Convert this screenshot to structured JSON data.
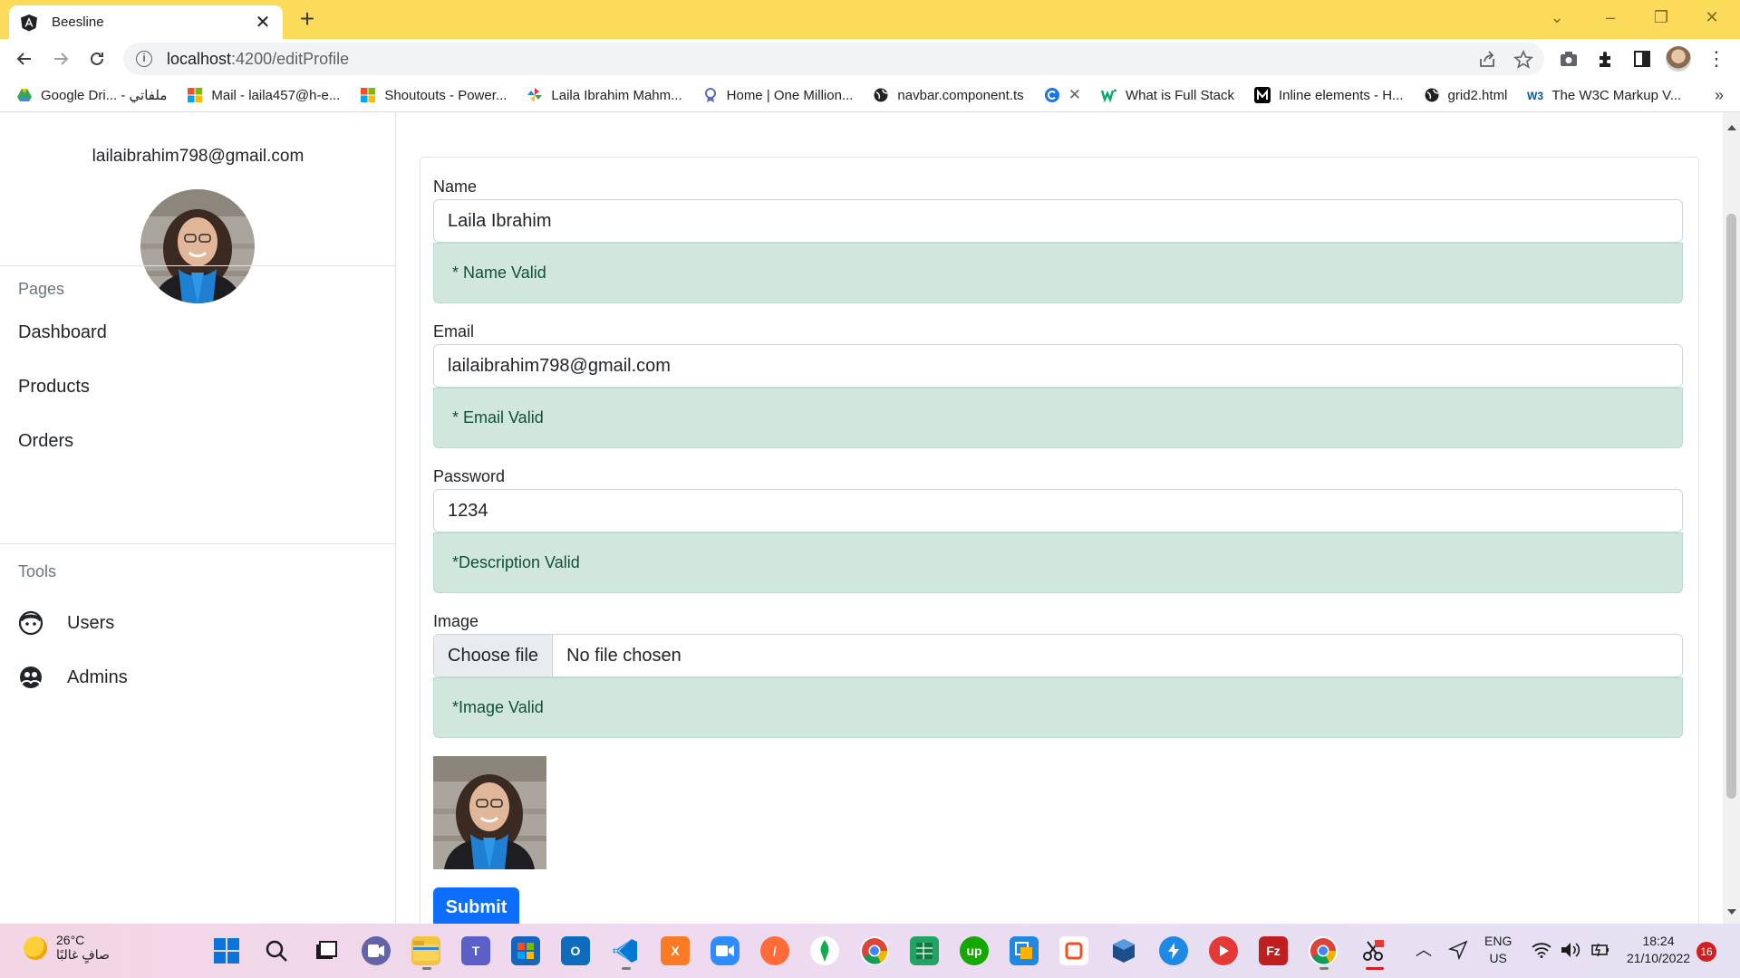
{
  "browser": {
    "tab_title": "Beesline",
    "url_host": "localhost",
    "url_path": ":4200/editProfile",
    "bookmarks": [
      {
        "label": "Google Dri... - ملفاتي",
        "icon": "google-drive-icon",
        "color": "#34a853"
      },
      {
        "label": "Mail - laila457@h-e...",
        "icon": "microsoft-icon",
        "color": "#f25022"
      },
      {
        "label": "Shoutouts - Power...",
        "icon": "microsoft-icon",
        "color": "#f25022"
      },
      {
        "label": "Laila Ibrahim Mahm...",
        "icon": "pinwheel-icon",
        "color": "#e53935"
      },
      {
        "label": "Home | One Million...",
        "icon": "badge-icon",
        "color": "#5c6bc0"
      },
      {
        "label": "navbar.component.ts",
        "icon": "globe-icon",
        "color": "#202124"
      },
      {
        "label": "",
        "icon": "c-icon",
        "color": "#1a73e8"
      },
      {
        "label": "What is Full Stack",
        "icon": "w-icon",
        "color": "#04aa6d"
      },
      {
        "label": "Inline elements - H...",
        "icon": "m-icon",
        "color": "#000000"
      },
      {
        "label": "grid2.html",
        "icon": "globe-icon",
        "color": "#202124"
      },
      {
        "label": "The W3C Markup V...",
        "icon": "w3c-icon",
        "color": "#005a9c"
      }
    ]
  },
  "sidebar": {
    "email": "lailaibrahim798@gmail.com",
    "pages_heading": "Pages",
    "pages": [
      {
        "label": "Dashboard"
      },
      {
        "label": "Products"
      },
      {
        "label": "Orders"
      }
    ],
    "tools_heading": "Tools",
    "tools": [
      {
        "label": "Users",
        "icon": "user-face-icon"
      },
      {
        "label": "Admins",
        "icon": "admins-icon"
      }
    ]
  },
  "form": {
    "name_label": "Name",
    "name_value": "Laila Ibrahim",
    "name_valid": "* Name Valid",
    "email_label": "Email",
    "email_value": "lailaibrahim798@gmail.com",
    "email_valid": "* Email Valid",
    "password_label": "Password",
    "password_value": "1234",
    "password_valid": "*Description Valid",
    "image_label": "Image",
    "file_button": "Choose file",
    "file_status": "No file chosen",
    "image_valid": "*Image Valid",
    "submit_label": "Submit"
  },
  "taskbar": {
    "temperature": "26°C",
    "weather_desc": "صافٍ غالبًا",
    "lang_line1": "ENG",
    "lang_line2": "US",
    "time": "18:24",
    "date": "21/10/2022",
    "notifications": "16"
  },
  "colors": {
    "titlebar": "#fcdb5a",
    "valid_bg": "#d1e7dd",
    "valid_text": "#0f5132",
    "primary": "#0d6efd"
  }
}
